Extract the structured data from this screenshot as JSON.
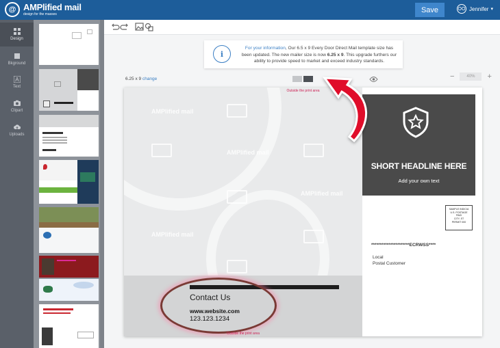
{
  "app": {
    "logo_name": "AMPlified mail",
    "logo_tagline": "design for the masses",
    "save_label": "Save",
    "user_name": "Jennifer",
    "user_initials": "OO"
  },
  "rail": [
    {
      "label": "Design",
      "icon": "grid-icon",
      "active": true
    },
    {
      "label": "Bkground",
      "icon": "square-icon",
      "active": false
    },
    {
      "label": "Text",
      "icon": "text-icon",
      "active": false
    },
    {
      "label": "Clipart",
      "icon": "camera-icon",
      "active": false
    },
    {
      "label": "Uploads",
      "icon": "upload-cloud-icon",
      "active": false
    }
  ],
  "notice": {
    "highlight": "For your information",
    "text_1": ", Our 6.5 x 9 Every Door Direct Mail template size has been updated. The new mailer size is now ",
    "bold_size": "6.25 x 9",
    "text_2": ". This upgrade furthers our ability to provide speed to market and exceed industry standards."
  },
  "canvas": {
    "size": "6.25 x 9",
    "change_link": "change",
    "zoom": "40%",
    "print_note": "Outside the print area"
  },
  "postcard": {
    "watermark": "AMPlified mail",
    "headline": "SHORT HEADLINE HERE",
    "subline": "Add your own text",
    "contact_title": "Contact Us",
    "website": "www.website.com",
    "phone": "123.123.1234",
    "stamp_lines": [
      "SAMPLE INDICIA",
      "U.S. POSTAGE",
      "PAID",
      "CITY, ST",
      "PERMIT 000"
    ],
    "ecrwss": "**********************ECRWSS****",
    "local": "Local",
    "postal_customer": "Postal Customer"
  },
  "colors": {
    "topbar": "#1d5d9a",
    "accent": "#3b7fc4",
    "annotation_arrow": "#e0102a",
    "ellipse": "#7a3a35"
  }
}
